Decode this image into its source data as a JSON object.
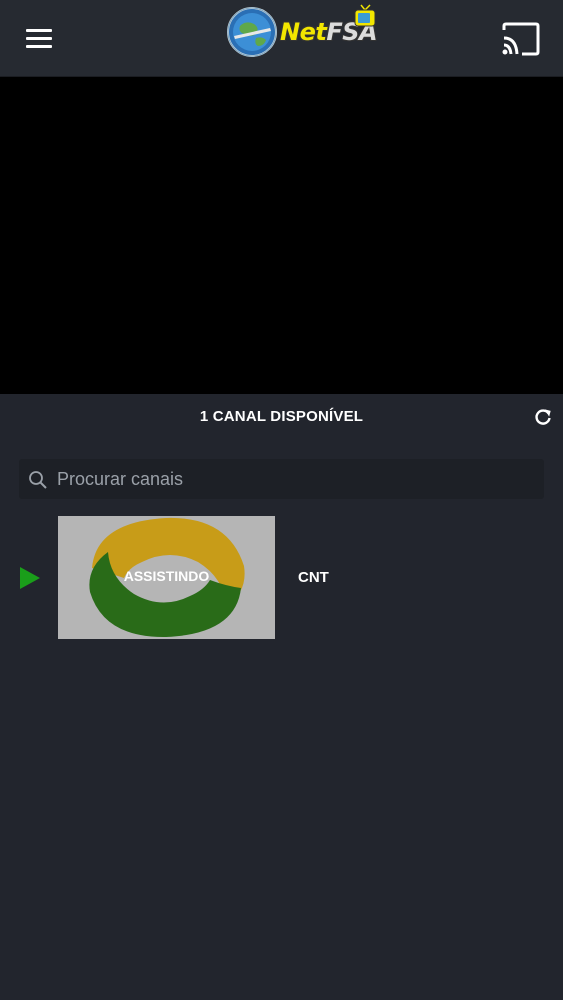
{
  "appbar": {
    "logo_text_net": "Net",
    "logo_text_fsa": "FSA",
    "icons": {
      "menu": "menu-icon",
      "cast": "cast-icon"
    }
  },
  "channels": {
    "count_label": "1 CANAL DISPONÍVEL",
    "refresh_icon": "refresh-icon",
    "search": {
      "placeholder": "Procurar canais",
      "icon": "search-icon"
    },
    "items": [
      {
        "name": "CNT",
        "thumb_label": "ASSISTINDO",
        "status_icon": "play-icon"
      }
    ]
  },
  "colors": {
    "background": "#22252d",
    "appbar": "#262a31",
    "player": "#000000",
    "play_indicator": "#1a9e1a",
    "logo_yellow": "#f2e600",
    "cnt_yellow": "#e4b21c",
    "cnt_green": "#2f7a1c"
  }
}
